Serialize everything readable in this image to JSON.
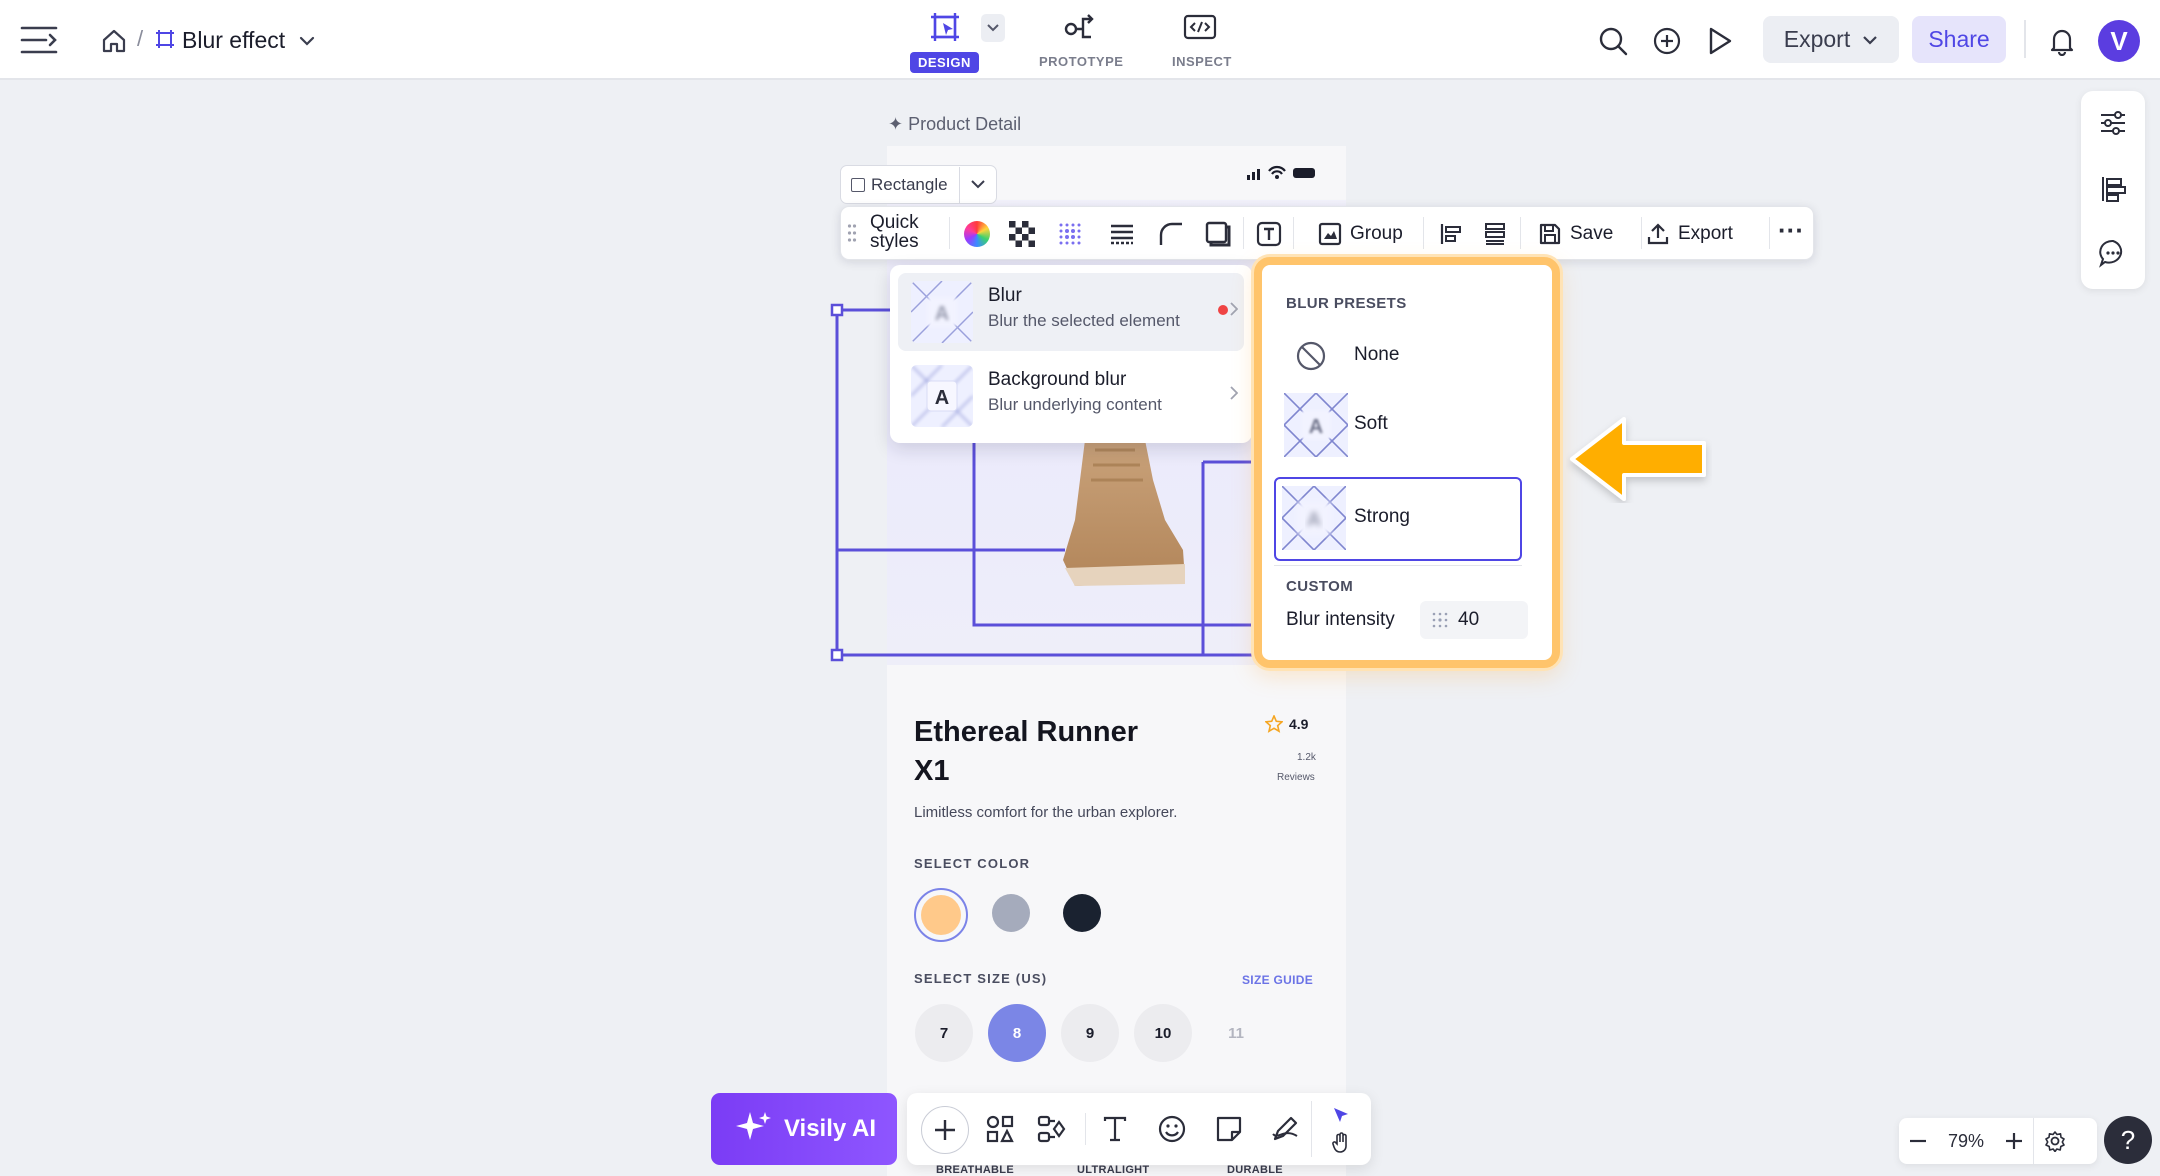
{
  "app": {
    "breadcrumb_separator": "/",
    "file_title": "Blur effect",
    "avatar_letter": "V"
  },
  "modes": [
    {
      "label": "DESIGN",
      "active": true
    },
    {
      "label": "PROTOTYPE",
      "active": false
    },
    {
      "label": "INSPECT",
      "active": false
    }
  ],
  "header_actions": {
    "export_label": "Export",
    "share_label": "Share"
  },
  "artboard": {
    "label": "Product Detail"
  },
  "selection": {
    "element_type": "Rectangle"
  },
  "toolbar": {
    "quick_styles_line1": "Quick",
    "quick_styles_line2": "styles",
    "group_label": "Group",
    "save_label": "Save",
    "export_label": "Export",
    "more": "···"
  },
  "blur_menu": {
    "items": [
      {
        "title": "Blur",
        "description": "Blur the selected element",
        "thumb_letter": "A"
      },
      {
        "title": "Background blur",
        "description": "Blur underlying content",
        "thumb_letter": "A"
      }
    ]
  },
  "blur_presets": {
    "header": "BLUR PRESETS",
    "presets": [
      {
        "label": "None"
      },
      {
        "label": "Soft",
        "thumb_letter": "A"
      },
      {
        "label": "Strong",
        "thumb_letter": "A",
        "selected": true
      }
    ],
    "custom_header": "CUSTOM",
    "intensity_label": "Blur intensity",
    "intensity_value": "40"
  },
  "product": {
    "title_line1": "Ethereal Runner",
    "title_line2": "X1",
    "rating": "4.9",
    "reviews_count": "1.2k",
    "reviews_label": "Reviews",
    "tagline": "Limitless comfort for the urban explorer.",
    "select_color_label": "SELECT COLOR",
    "colors": [
      "#ffc98a",
      "#a5abbc",
      "#1a2230"
    ],
    "select_size_label": "SELECT SIZE (US)",
    "size_guide_label": "SIZE GUIDE",
    "sizes": [
      "7",
      "8",
      "9",
      "10",
      "11"
    ],
    "selected_size": "8",
    "features": [
      "BREATHABLE",
      "ULTRALIGHT",
      "DURABLE"
    ]
  },
  "bottom": {
    "ai_label": "Visily AI",
    "zoom_level": "79%",
    "help": "?"
  },
  "colors": {
    "accent": "#4f46e5",
    "highlight_border": "#ffc46b",
    "arrow": "#ffae00",
    "selection": "#5b4fd9"
  }
}
